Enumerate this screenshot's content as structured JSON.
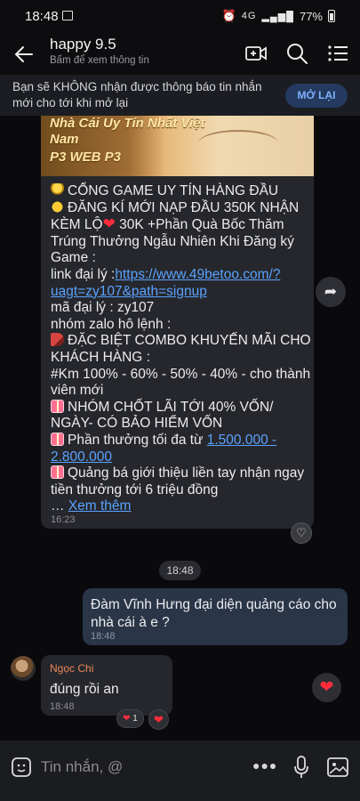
{
  "status": {
    "time": "18:48",
    "battery": "77%",
    "signal": "4G"
  },
  "header": {
    "title": "happy 9.5",
    "subtitle": "Bấm để xem thông tin"
  },
  "notice": {
    "text": "Bạn sẽ KHÔNG nhận được thông báo tin nhắn mới cho tới khi mở lại",
    "button": "MỞ LẠI"
  },
  "message1": {
    "banner_line1": "Nhà Cái Uy Tín Nhất Việt",
    "banner_line2": "Nam",
    "banner_line3": "P3 WEB P3",
    "l1": "CỔNG GAME UY TÍN HÀNG ĐẦU",
    "l2": "ĐĂNG KÍ MỚI NẠP ĐẦU 350K  NHẬN",
    "l3a": "KÈM LỘ",
    "l3b": " 30K  +Phần Quà Bốc Thăm",
    "l4": "Trúng Thưởng Ngẫu Nhiên Khi Đăng ký",
    "l5": "Game :",
    "l6a": "link đại lý :",
    "l6b": "https://www.49betoo.com/?",
    "l7": "uagt=zy107&path=signup",
    "l8": "mã đại lý : zy107",
    "l9": "nhóm zalo hô lệnh :",
    "l10": "ĐẶC BIỆT COMBO KHUYẾN MÃI CHO",
    "l11": "KHÁCH HÀNG :",
    "l12": "#Km  100% - 60% - 50% - 40% - cho thành",
    "l13": "viên mới",
    "l14": "NHÓM CHỐT LÃI TỚI 40% VỐN/",
    "l15": "NGÀY- CÓ BẢO HIỂM VỐN",
    "l16a": "Phần thưởng tối đa từ ",
    "l16b": "1.500.000 -",
    "l17": "2.800.000",
    "l18": "Quảng bá giới thiệu liền tay nhận ngay",
    "l19": "tiền thưởng tới 6 triệu đồng",
    "l20a": "… ",
    "see_more": "Xem thêm",
    "time": "16:23"
  },
  "divider_time": "18:48",
  "message2": {
    "text": "Đàm Vĩnh Hưng đại diện quảng cáo cho nhà cái à e ?",
    "time": "18:48"
  },
  "message3": {
    "sender": "Ngọc Chi",
    "text": "đúng rồi an",
    "time": "18:48",
    "reaction_count": "1"
  },
  "composer": {
    "placeholder": "Tin nhắn, @"
  },
  "colors": {
    "link": "#5aa2ff",
    "heart": "#ff2d3c",
    "sender": "#e8865a"
  }
}
